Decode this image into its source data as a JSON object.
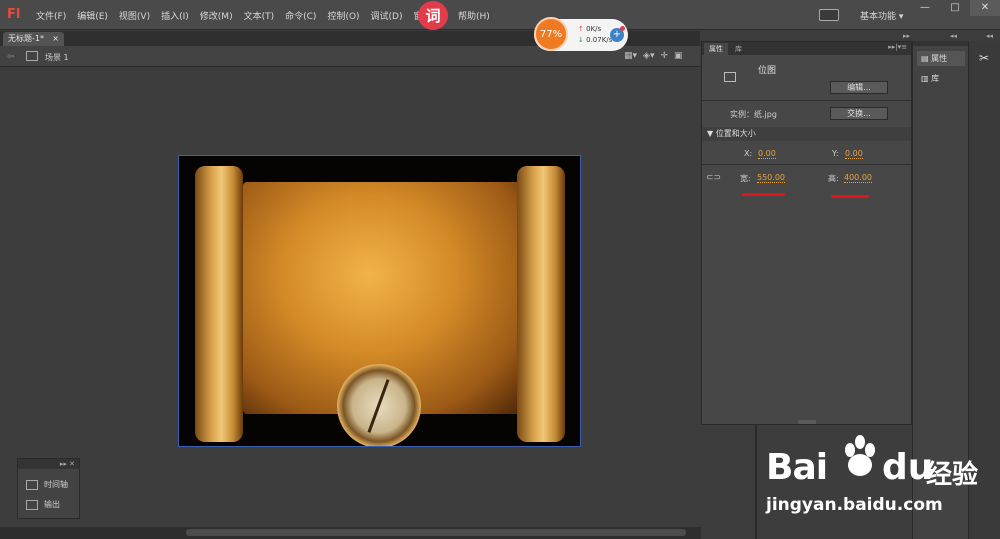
{
  "app": {
    "logo": "Fl",
    "menu": [
      "文件(F)",
      "编辑(E)",
      "视图(V)",
      "插入(I)",
      "修改(M)",
      "文本(T)",
      "命令(C)",
      "控制(O)",
      "调试(D)",
      "窗"
    ],
    "ci_badge": "词",
    "help": "帮助(H)",
    "workspace": "基本功能",
    "window_buttons": [
      "—",
      "□",
      "✕"
    ]
  },
  "speed_widget": {
    "percent": "77%",
    "up": "0K/s",
    "down": "0.07K/s",
    "plus": "+"
  },
  "document": {
    "tab_label": "无标题-1*",
    "tab_close": "×",
    "scene": "场景 1"
  },
  "timeline_panel": {
    "header": "▸▸ ✕",
    "items": [
      "时间轴",
      "输出"
    ]
  },
  "properties": {
    "tabs": [
      "属性",
      "库"
    ],
    "menu": "▸▸|▾≡",
    "symbol_type": "位图",
    "edit_button": "编辑...",
    "instance_label": "实例：纸.jpg",
    "swap_button": "交换...",
    "section_title": "▼ 位置和大小",
    "x_label": "X:",
    "x_value": "0.00",
    "y_label": "Y:",
    "y_value": "0.00",
    "w_label": "宽:",
    "w_value": "550.00",
    "h_label": "高:",
    "h_value": "400.00"
  },
  "right_dock": {
    "items": [
      "属性",
      "库"
    ]
  },
  "watermark": {
    "brand_latin": "Bai",
    "brand_du": "du",
    "brand_cn": "经验",
    "url": "jingyan.baidu.com"
  },
  "colors": {
    "accent_orange": "#e8a33a",
    "annotation_red": "#e3151b",
    "logo_red": "#e84a3c"
  }
}
